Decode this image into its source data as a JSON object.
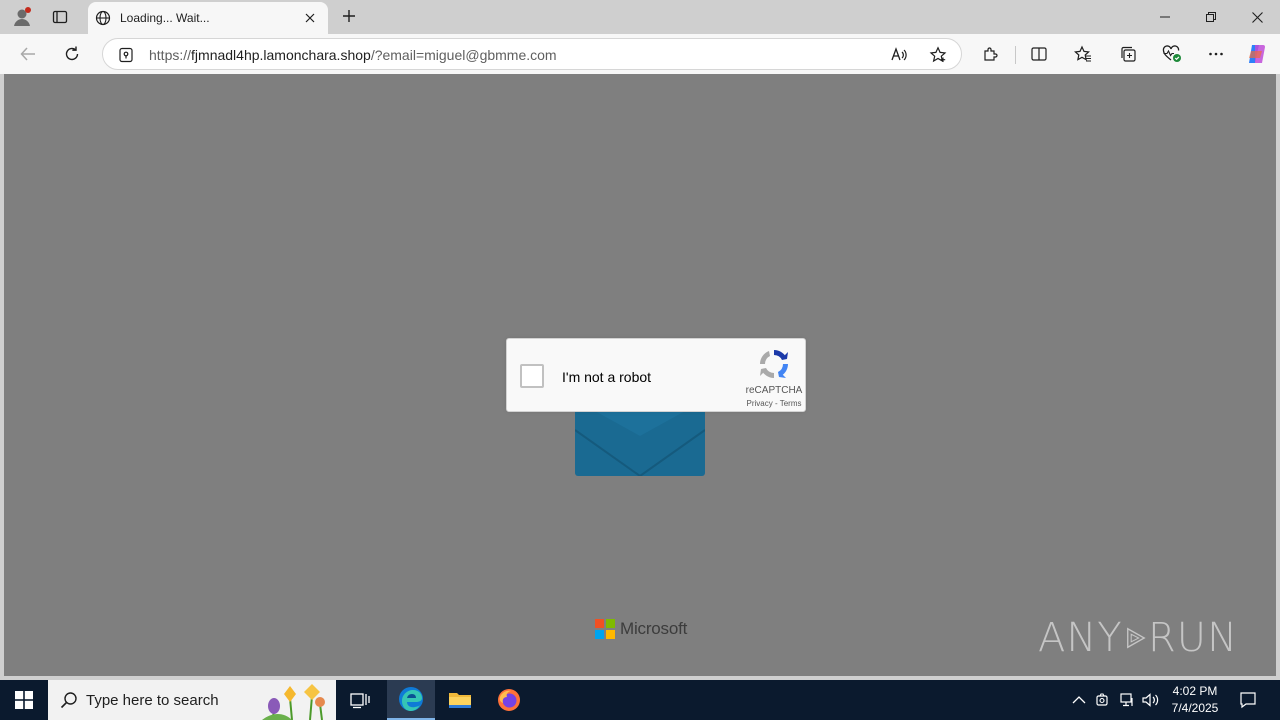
{
  "browser": {
    "tab": {
      "title": "Loading... Wait..."
    },
    "address": {
      "scheme": "https://",
      "host": "fjmnadl4hp.lamonchara.shop",
      "path": "/?email=miguel@gbmme.com"
    }
  },
  "page": {
    "recaptcha": {
      "checkbox_label": "I'm not a robot",
      "brand": "reCAPTCHA",
      "privacy_link": "Privacy",
      "separator": " - ",
      "terms_link": "Terms"
    },
    "footer": {
      "brand": "Microsoft"
    },
    "watermark": {
      "left": "ANY",
      "right": "RUN"
    }
  },
  "taskbar": {
    "search_placeholder": "Type here to search",
    "clock": {
      "time": "4:02 PM",
      "date": "7/4/2025"
    }
  },
  "colors": {
    "page_background": "#7f7f7f",
    "envelope": "#1a6a92",
    "taskbar": "#0b1a2e",
    "ms_red": "#f25022",
    "ms_green": "#7fba00",
    "ms_blue": "#00a4ef",
    "ms_yellow": "#ffb900"
  },
  "icons": {
    "profile": "profile-icon",
    "tab_actions": "tab-actions-icon",
    "favicon": "globe-icon",
    "tab_close": "close-icon",
    "new_tab": "plus-icon",
    "back": "back-arrow-icon",
    "refresh": "refresh-icon",
    "site_info": "site-info-icon",
    "read_aloud": "read-aloud-icon",
    "favorite": "star-icon",
    "extensions": "puzzle-icon",
    "split_screen": "split-screen-icon",
    "favorites": "favorites-icon",
    "collections": "collections-icon",
    "browser_essentials": "heart-pulse-icon",
    "more": "ellipsis-icon",
    "copilot": "copilot-icon"
  }
}
